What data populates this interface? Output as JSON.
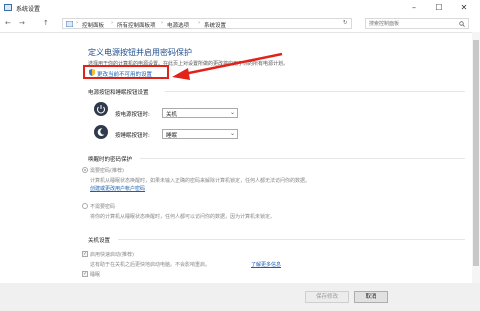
{
  "window": {
    "title": "系统设置",
    "minimize": "–",
    "maximize": "☐",
    "close": "✕"
  },
  "address": {
    "back": "←",
    "forward": "→",
    "up": "↑",
    "crumbs": [
      "控制面板",
      "所有控制面板项",
      "电源选项",
      "系统设置"
    ],
    "separator": "›",
    "refresh": "↻",
    "search_placeholder": "搜索控制面板",
    "search_icon": "search-icon"
  },
  "main": {
    "heading": "定义电源按钮并启用密码保护",
    "description": "选择用于你的计算机的电源设置。在此页上对设置所做的更改将应用于你的所有电源计划。",
    "change_link": "更改当前不可用的设置",
    "power_section": {
      "title": "电源按钮和睡眠按钮设置",
      "rows": [
        {
          "label": "按电源按钮时:",
          "value": "关机",
          "icon": "power-icon"
        },
        {
          "label": "按睡眠按钮时:",
          "value": "睡眠",
          "icon": "sleep-icon"
        }
      ]
    },
    "password_section": {
      "title": "唤醒时的密码保护",
      "require": {
        "label": "需要密码(推荐)",
        "desc": "计算机从睡眠状态唤醒时，如果未输入正确的密码来解除计算机锁定，任何人都无法访问你的数据。",
        "link": "创建或更改用户帐户密码"
      },
      "norequire": {
        "label": "不需要密码",
        "desc": "将你的计算机从睡眠状态唤醒时，任何人都可以访问你的数据，因为计算机未锁定。"
      }
    },
    "shutdown_section": {
      "title": "关机设置",
      "fast_startup": {
        "label": "启用快速启动(推荐)",
        "desc": "这有助于在关机之后更快地启动电脑。不会影响重启。",
        "link": "了解更多信息"
      },
      "sleep": {
        "label": "睡眠"
      }
    }
  },
  "footer": {
    "save": "保存修改",
    "cancel": "取消"
  },
  "colors": {
    "accent": "#1e4e8c",
    "link": "#1a5fb4",
    "highlight": "#e2231a"
  }
}
